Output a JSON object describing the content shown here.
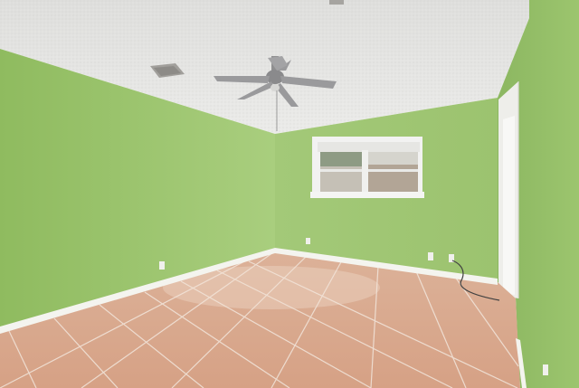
{
  "scene": {
    "subject": "empty-room",
    "colors": {
      "ceiling": "#e6e6e4",
      "ceiling_shadow": "#d4d4d2",
      "left_wall": "#9cc56e",
      "back_wall": "#a6cc7a",
      "right_wall": "#94bd69",
      "baseboard": "#f1f1ec",
      "floor_base": "#d9a88c",
      "floor_grout": "#efe4dc",
      "window_frame": "#f3f3f3",
      "fan_blade": "#9a9a9c",
      "vent": "#9d9c98",
      "door_frame": "#f2f2ef"
    },
    "icons": [
      "ceiling-fan-icon",
      "air-vent-icon",
      "window-icon",
      "outlet-icon",
      "door-frame-icon",
      "power-cord-icon"
    ]
  }
}
